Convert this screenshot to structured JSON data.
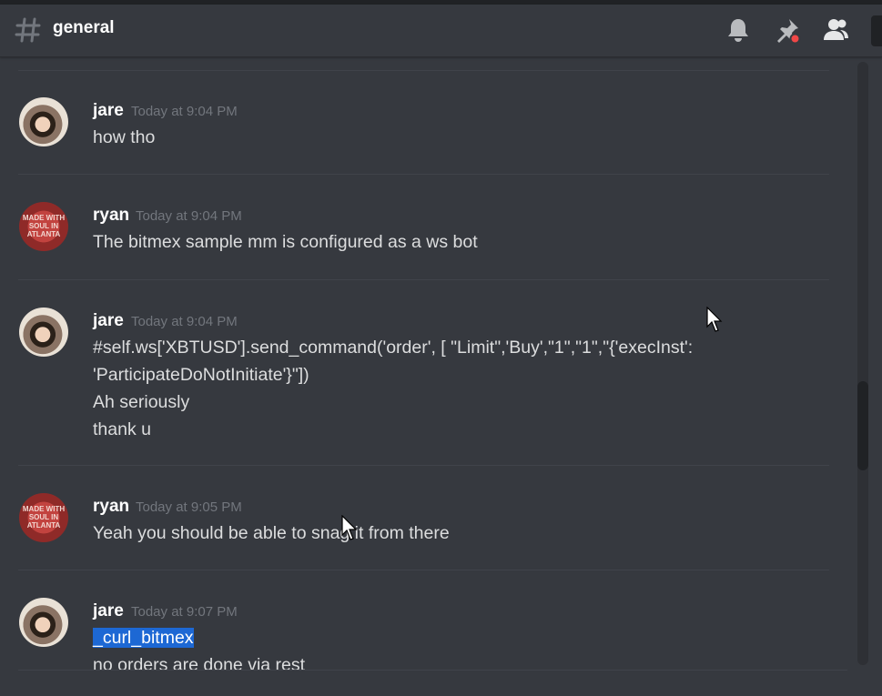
{
  "header": {
    "channel_name": "general",
    "icons": [
      "hash-icon",
      "bell-icon",
      "pin-icon",
      "members-icon"
    ]
  },
  "messages": [
    {
      "author": "jare",
      "timestamp": "Today at 9:04 PM",
      "avatar": "jare",
      "lines": [
        "how tho"
      ]
    },
    {
      "author": "ryan",
      "timestamp": "Today at 9:04 PM",
      "avatar": "ryan",
      "lines": [
        "The bitmex sample mm is configured as a ws bot"
      ]
    },
    {
      "author": "jare",
      "timestamp": "Today at 9:04 PM",
      "avatar": "jare",
      "lines": [
        "#self.ws['XBTUSD'].send_command('order', [ \"Limit\",'Buy',\"1\",\"1\",\"{'execInst':",
        "'ParticipateDoNotInitiate'}\"])",
        "Ah seriously",
        "thank u"
      ]
    },
    {
      "author": "ryan",
      "timestamp": "Today at 9:05 PM",
      "avatar": "ryan",
      "lines": [
        "Yeah you should be able to snag it from there"
      ]
    },
    {
      "author": "jare",
      "timestamp": "Today at 9:07 PM",
      "avatar": "jare",
      "lines": [
        "_curl_bitmex",
        "no orders are done via rest"
      ],
      "selected_line": "_curl_bitmex"
    }
  ],
  "avatar_ryan_text": "MADE WITH SOUL IN ATLANTA",
  "colors": {
    "background": "#36393f",
    "username": "#ffffff",
    "timestamp": "#72767d",
    "message_text": "#dcddde",
    "selection": "#1d68d4",
    "notification_dot": "#f04747"
  }
}
